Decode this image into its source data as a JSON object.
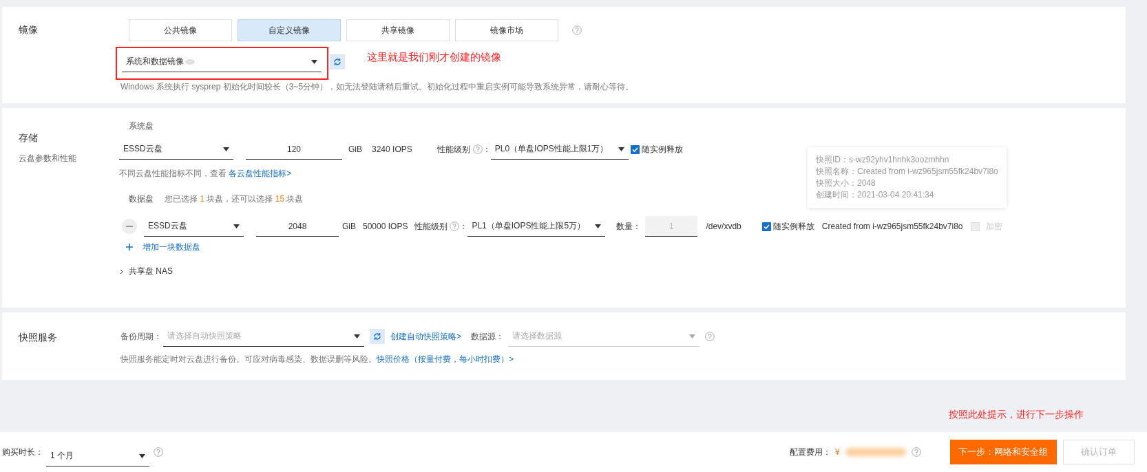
{
  "image_section": {
    "label": "镜像",
    "tabs": [
      {
        "label": "公共镜像",
        "selected": false
      },
      {
        "label": "自定义镜像",
        "selected": true
      },
      {
        "label": "共享镜像",
        "selected": false
      },
      {
        "label": "镜像市场",
        "selected": false
      }
    ],
    "select": {
      "value": "系统和数据镜像"
    },
    "hint": "Windows 系统执行 sysprep 初始化时间较长（3~5分钟），如无法登陆请稍后重试。初始化过程中重启实例可能导致系统异常，请耐心等待。"
  },
  "storage": {
    "label": "存储",
    "sublabel": "云盘参数和性能",
    "system_disk": {
      "title": "系统盘",
      "type": "ESSD云盘",
      "size": "120",
      "unit": "GiB",
      "iops": "3240 IOPS",
      "level_label": "性能级别",
      "level_separator": "：",
      "level": "PL0（单盘IOPS性能上限1万）",
      "release": {
        "label": "随实例释放",
        "checked": true
      },
      "hint": "不同云盘性能指标不同，查看 ",
      "hint_link": "各云盘性能指标>"
    },
    "data_disk": {
      "title": "数据盘",
      "note_parts": [
        {
          "text": "您已选择 ",
          "highlight": false
        },
        {
          "text": "1",
          "highlight": true
        },
        {
          "text": " 块盘，还可以选择 ",
          "highlight": false
        },
        {
          "text": "15",
          "highlight": true
        },
        {
          "text": " 块盘",
          "highlight": false
        }
      ],
      "disks": [
        {
          "type": "ESSD云盘",
          "size": "2048",
          "unit": "GiB",
          "iops": "50000 IOPS",
          "level_label": "性能级别",
          "level_separator": "：",
          "level": "PL1（单盘IOPS性能上限5万）",
          "count_label": "数量：",
          "count": "1",
          "device": "/dev/xvdb",
          "release": {
            "label": "随实例释放",
            "checked": true
          },
          "snapshot": "Created from i-wz965jsm55fk24bv7i8o",
          "encrypt": {
            "label": "加密",
            "checked": false,
            "disabled": true
          }
        }
      ],
      "add": "增加一块数据盘",
      "tooltip": [
        "快照ID：s-wz92yhv1hnhk3oozmhhn",
        "快照名称：Created from i-wz965jsm55fk24bv7i8o",
        "快照大小：2048",
        "创建时间：2021-03-04 20:41:34"
      ]
    },
    "nas": {
      "label": "共享盘 NAS",
      "expanded": false
    }
  },
  "snapshot_service": {
    "label": "快照服务",
    "period_label": "备份周期：",
    "period_placeholder": "请选择自动快照策略",
    "create_link": "创建自动快照策略>",
    "source_label": "数据源：",
    "source_placeholder": "请选择数据源",
    "hint": "快照服务能定时对云盘进行备份。可应对病毒感染、数据误删等风险。",
    "hint_link": "快照价格（按量付费，每小时扣费）>"
  },
  "footer": {
    "duration_label": "购买时长：",
    "duration": "1 个月",
    "cost_label": "配置费用：",
    "currency": "¥",
    "next": "下一步：网络和安全组",
    "confirm": {
      "label": "确认订单",
      "disabled": true
    }
  },
  "annotations": [
    {
      "kind": "image",
      "text": "这里就是我们刚才创建的镜像"
    },
    {
      "kind": "footer",
      "text": "按照此处提示，进行下一步操作"
    }
  ]
}
